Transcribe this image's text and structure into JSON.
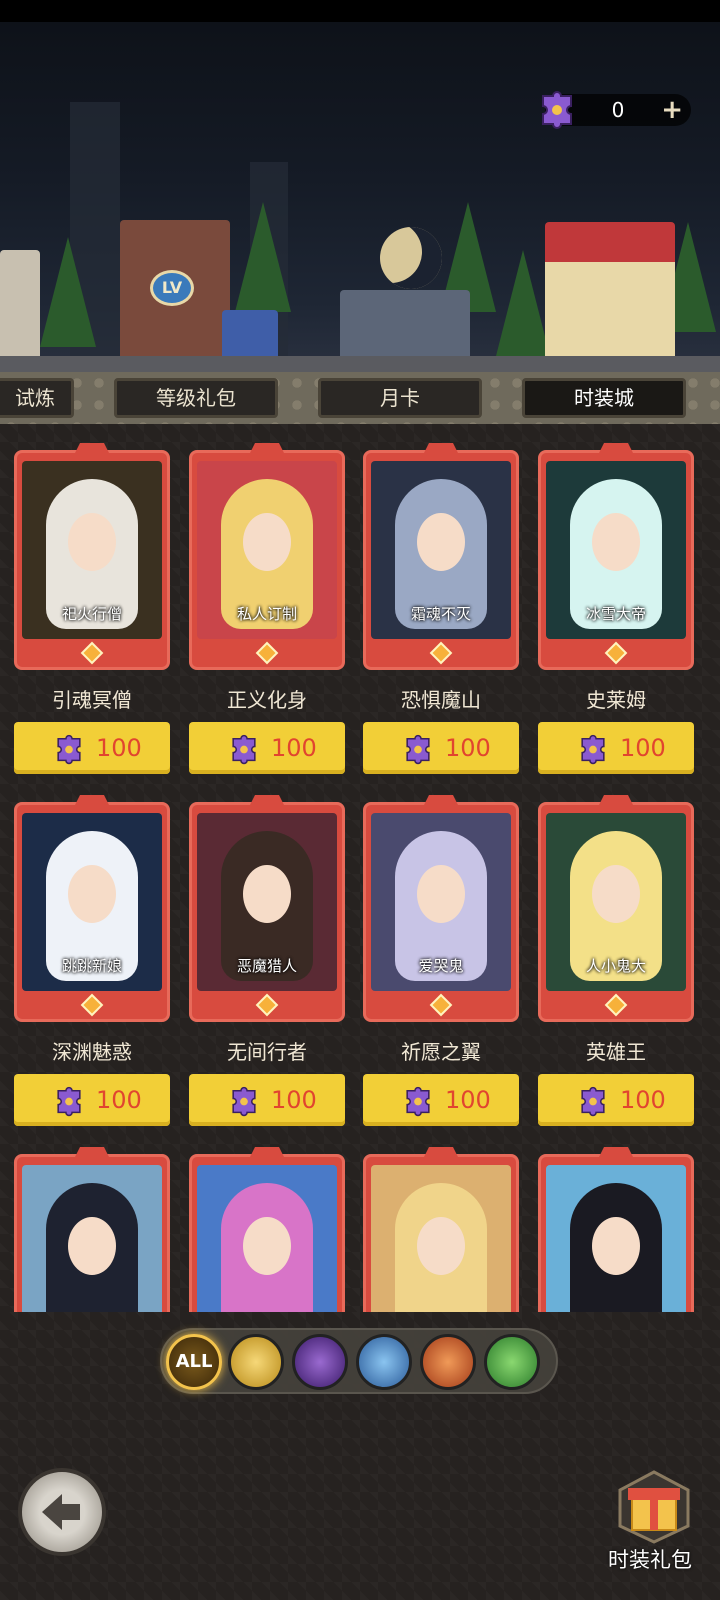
{
  "currency": {
    "icon": "puzzle-piece-icon",
    "value": "0",
    "add_icon": "plus-icon"
  },
  "tabs": [
    {
      "label": "试炼"
    },
    {
      "label": "等级礼包"
    },
    {
      "label": "月卡"
    },
    {
      "label": "时装城",
      "active": true
    }
  ],
  "banner": {
    "level_sign": "LV"
  },
  "price_icon": "puzzle-piece-icon",
  "skins": [
    {
      "skin": "祀火行僧",
      "hero": "引魂冥僧",
      "price": "100",
      "hair": "#e8e4dc",
      "bg": "#3a3020"
    },
    {
      "skin": "私人订制",
      "hero": "正义化身",
      "price": "100",
      "hair": "#f0d070",
      "bg": "#c9454a"
    },
    {
      "skin": "霜魂不灭",
      "hero": "恐惧魔山",
      "price": "100",
      "hair": "#9aa8c4",
      "bg": "#2a3246"
    },
    {
      "skin": "冰雪大帝",
      "hero": "史莱姆",
      "price": "100",
      "hair": "#d6f4f0",
      "bg": "#1d3a3a"
    },
    {
      "skin": "跳跳新娘",
      "hero": "深渊魅惑",
      "price": "100",
      "hair": "#eef2f8",
      "bg": "#1c2c48"
    },
    {
      "skin": "恶魔猎人",
      "hero": "无间行者",
      "price": "100",
      "hair": "#3a2a24",
      "bg": "#5a2a34"
    },
    {
      "skin": "爱哭鬼",
      "hero": "祈愿之翼",
      "price": "100",
      "hair": "#c8c4e6",
      "bg": "#4a4a6e"
    },
    {
      "skin": "人小鬼大",
      "hero": "英雄王",
      "price": "100",
      "hair": "#f3e088",
      "bg": "#2a4a38"
    },
    {
      "skin": "",
      "hero": "",
      "price": "",
      "hair": "#1e2230",
      "bg": "#7aa4c4"
    },
    {
      "skin": "",
      "hero": "",
      "price": "",
      "hair": "#d874c8",
      "bg": "#4a7ac8"
    },
    {
      "skin": "",
      "hero": "",
      "price": "",
      "hair": "#f0d48a",
      "bg": "#dcb070"
    },
    {
      "skin": "",
      "hero": "",
      "price": "",
      "hair": "#1a1a22",
      "bg": "#6ab0d8"
    }
  ],
  "factions": [
    {
      "name": "ALL",
      "icon": "all-filter-icon",
      "color": "#7a5a1c"
    },
    {
      "name": "",
      "icon": "light-faction-icon",
      "color": "#d8b040"
    },
    {
      "name": "",
      "icon": "dark-faction-icon",
      "color": "#5a3a8a"
    },
    {
      "name": "",
      "icon": "sword-faction-icon",
      "color": "#3a7ab8"
    },
    {
      "name": "",
      "icon": "wolf-faction-icon",
      "color": "#c8582a"
    },
    {
      "name": "",
      "icon": "tree-faction-icon",
      "color": "#4a9a3a"
    }
  ],
  "back_icon": "back-arrow-icon",
  "gift": {
    "icon": "gift-box-icon",
    "label": "时装礼包"
  }
}
